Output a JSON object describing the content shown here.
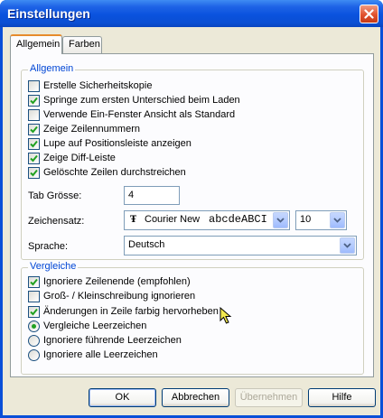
{
  "window": {
    "title": "Einstellungen"
  },
  "tabs": [
    {
      "label": "Allgemein",
      "active": true
    },
    {
      "label": "Farben",
      "active": false
    }
  ],
  "allgemein": {
    "title": "Allgemein",
    "checkboxes": [
      {
        "label": "Erstelle Sicherheitskopie",
        "checked": false
      },
      {
        "label": "Springe zum ersten Unterschied beim Laden",
        "checked": true
      },
      {
        "label": "Verwende Ein-Fenster Ansicht als Standard",
        "checked": false
      },
      {
        "label": "Zeige Zeilennummern",
        "checked": true
      },
      {
        "label": "Lupe auf Positionsleiste anzeigen",
        "checked": true
      },
      {
        "label": "Zeige Diff-Leiste",
        "checked": true
      },
      {
        "label": "Gelöschte Zeilen durchstreichen",
        "checked": true
      }
    ],
    "tab_size_label": "Tab Grösse:",
    "tab_size_value": "4",
    "font_label": "Zeichensatz:",
    "font_name": "Courier New",
    "font_preview": "abcdeABCI",
    "font_size": "10",
    "language_label": "Sprache:",
    "language_value": "Deutsch"
  },
  "vergleiche": {
    "title": "Vergleiche",
    "checkboxes": [
      {
        "label": "Ignoriere Zeilenende (empfohlen)",
        "checked": true
      },
      {
        "label": "Groß- / Kleinschreibung ignorieren",
        "checked": false
      },
      {
        "label": "Änderungen in Zeile farbig hervorheben",
        "checked": true
      }
    ],
    "radios": [
      {
        "label": "Vergleiche Leerzeichen",
        "selected": true
      },
      {
        "label": "Ignoriere führende Leerzeichen",
        "selected": false
      },
      {
        "label": "Ignoriere alle Leerzeichen",
        "selected": false
      }
    ]
  },
  "buttons": {
    "ok": "OK",
    "cancel": "Abbrechen",
    "apply": "Übernehmen",
    "help": "Hilfe"
  },
  "colors": {
    "checkmark": "#21a121",
    "accent": "#0046d5",
    "titlebar": "#0a52de"
  }
}
